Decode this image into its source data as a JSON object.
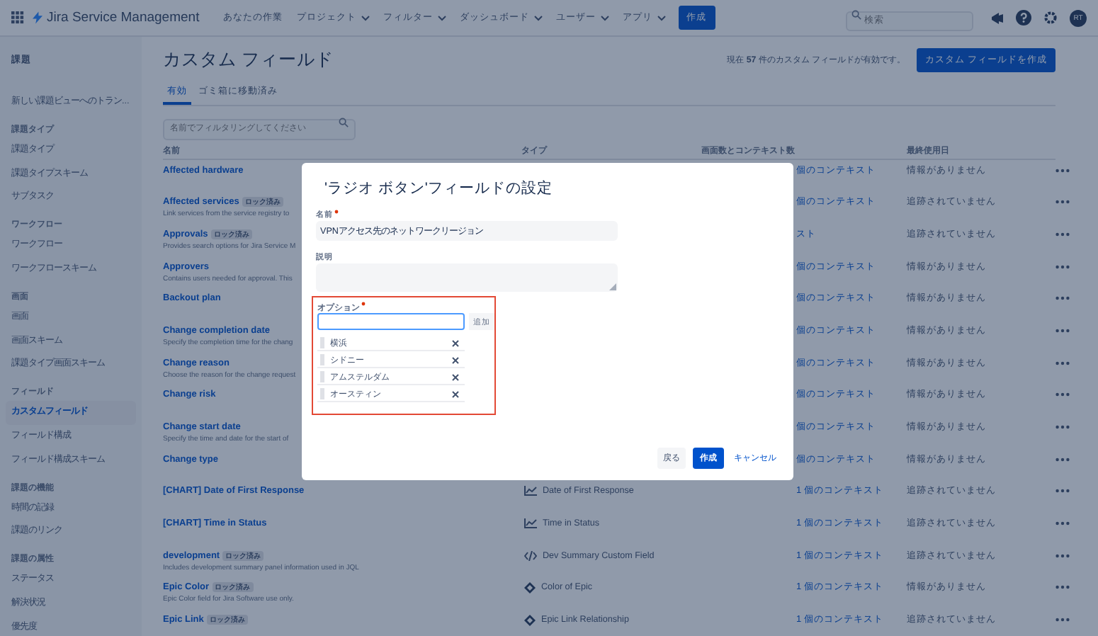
{
  "top_nav": {
    "product": "Jira Service Management",
    "menus": [
      {
        "label": "あなたの作業",
        "dropdown": false
      },
      {
        "label": "プロジェクト",
        "dropdown": true
      },
      {
        "label": "フィルター",
        "dropdown": true
      },
      {
        "label": "ダッシュボード",
        "dropdown": true
      },
      {
        "label": "ユーザー",
        "dropdown": true
      },
      {
        "label": "アプリ",
        "dropdown": true
      }
    ],
    "create_button": "作成",
    "search": {
      "placeholder": "検索"
    },
    "avatar": "RT"
  },
  "sidebar": {
    "title": "課題",
    "items": [
      {
        "kind": "link",
        "label": "新しい課題ビューへのトラン...",
        "selected": false
      },
      {
        "kind": "heading",
        "label": "課題タイプ"
      },
      {
        "kind": "link",
        "label": "課題タイプ",
        "selected": false
      },
      {
        "kind": "link",
        "label": "課題タイプスキーム",
        "selected": false
      },
      {
        "kind": "link",
        "label": "サブタスク",
        "selected": false
      },
      {
        "kind": "heading",
        "label": "ワークフロー"
      },
      {
        "kind": "link",
        "label": "ワークフロー",
        "selected": false
      },
      {
        "kind": "link",
        "label": "ワークフロースキーム",
        "selected": false
      },
      {
        "kind": "heading",
        "label": "画面"
      },
      {
        "kind": "link",
        "label": "画面",
        "selected": false
      },
      {
        "kind": "link",
        "label": "画面スキーム",
        "selected": false
      },
      {
        "kind": "link",
        "label": "課題タイプ画面スキーム",
        "selected": false
      },
      {
        "kind": "heading",
        "label": "フィールド"
      },
      {
        "kind": "link",
        "label": "カスタムフィールド",
        "selected": true
      },
      {
        "kind": "link",
        "label": "フィールド構成",
        "selected": false
      },
      {
        "kind": "link",
        "label": "フィールド構成スキーム",
        "selected": false
      },
      {
        "kind": "heading",
        "label": "課題の機能"
      },
      {
        "kind": "link",
        "label": "時間の記録",
        "selected": false
      },
      {
        "kind": "link",
        "label": "課題のリンク",
        "selected": false
      },
      {
        "kind": "heading",
        "label": "課題の属性"
      },
      {
        "kind": "link",
        "label": "ステータス",
        "selected": false
      },
      {
        "kind": "link",
        "label": "解決状況",
        "selected": false
      },
      {
        "kind": "link",
        "label": "優先度",
        "selected": false
      }
    ]
  },
  "page": {
    "title": "カスタム フィールド",
    "summary": "現在 **57** 件のカスタム フィールドが有効です。",
    "create_button": "カスタム フィールドを作成",
    "tabs": [
      {
        "label": "有効",
        "selected": true
      },
      {
        "label": "ゴミ箱に移動済み",
        "selected": false
      }
    ],
    "filter": {
      "placeholder": "名前でフィルタリングしてください"
    }
  },
  "table": {
    "columns": [
      "名前",
      "タイプ",
      "画面数とコンテキスト数",
      "最終使用日"
    ],
    "rows": [
      {
        "name": "Affected hardware",
        "context": "個のコンテキスト",
        "last_used": "情報がありません"
      },
      {
        "name": "Affected services",
        "badge": "ロック済み",
        "description": "Link services from the service registry to",
        "context": "個のコンテキスト",
        "last_used": "追跡されていません"
      },
      {
        "name": "Approvals",
        "badge": "ロック済み",
        "description": "Provides search options for Jira Service M",
        "context": "スト",
        "last_used": "追跡されていません"
      },
      {
        "name": "Approvers",
        "description": "Contains users needed for approval. This",
        "context": "個のコンテキスト",
        "last_used": "情報がありません"
      },
      {
        "name": "Backout plan",
        "context": "個のコンテキスト",
        "last_used": "情報がありません"
      },
      {
        "name": "Change completion date",
        "description": "Specify the completion time for the chang",
        "context": "個のコンテキスト",
        "last_used": "情報がありません"
      },
      {
        "name": "Change reason",
        "description": "Choose the reason for the change request",
        "context": "個のコンテキスト",
        "last_used": "情報がありません"
      },
      {
        "name": "Change risk",
        "context": "個のコンテキスト",
        "last_used": "情報がありません"
      },
      {
        "name": "Change start date",
        "description": "Specify the time and date for the start of",
        "context": "個のコンテキスト",
        "last_used": "情報がありません"
      },
      {
        "name": "Change type",
        "context": "個のコンテキスト",
        "last_used": "情報がありません"
      },
      {
        "name": "[CHART] Date of First Response",
        "kind": "chart",
        "type": "Date of First Response",
        "context": "1 個のコンテキスト",
        "last_used": "追跡されていません"
      },
      {
        "name": "[CHART] Time in Status",
        "kind": "chart",
        "type": "Time in Status",
        "context": "1 個のコンテキスト",
        "last_used": "追跡されていません"
      },
      {
        "name": "development",
        "badge": "ロック済み",
        "description": "Includes development summary panel information used in JQL",
        "kind": "code",
        "type": "Dev Summary Custom Field",
        "context": "1 個のコンテキスト",
        "last_used": "追跡されていません"
      },
      {
        "name": "Epic Color",
        "badge": "ロック済み",
        "description": "Epic Color field for Jira Software use only.",
        "kind": "epic",
        "type": "Color of Epic",
        "context": "1 個のコンテキスト",
        "last_used": "情報がありません"
      },
      {
        "name": "Epic Link",
        "badge": "ロック済み",
        "kind": "epic",
        "type": "Epic Link Relationship",
        "context": "1 個のコンテキスト",
        "last_used": "追跡されていません"
      }
    ]
  },
  "dialog": {
    "title": "'ラジオ ボタン'フィールドの設定",
    "name_field": {
      "label": "名前",
      "required": true,
      "value": "VPNアクセス先のネットワークリージョン"
    },
    "description_field": {
      "label": "説明"
    },
    "options": {
      "label": "オプション",
      "required": true,
      "highlighted": true,
      "add_button": "追加",
      "items": [
        "横浜",
        "シドニー",
        "アムステルダム",
        "オースティン"
      ]
    },
    "buttons": [
      {
        "kind": "secondary",
        "label": "戻る"
      },
      {
        "kind": "primary",
        "label": "作成"
      },
      {
        "kind": "link",
        "label": "キャンセル"
      }
    ]
  }
}
